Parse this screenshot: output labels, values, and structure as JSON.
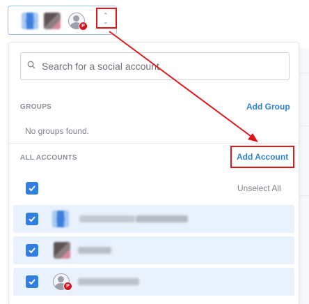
{
  "search": {
    "placeholder": "Search for a social account"
  },
  "groups": {
    "label": "GROUPS",
    "add_label": "Add Group",
    "empty_text": "No groups found."
  },
  "accounts": {
    "label": "ALL ACCOUNTS",
    "add_label": "Add Account",
    "unselect_label": "Unselect All",
    "items": [
      {
        "avatar": "blurred-blue-avatar",
        "checked": true,
        "name_redacted": true
      },
      {
        "avatar": "blurred-gray-avatar",
        "checked": true,
        "name_redacted": true
      },
      {
        "avatar": "default-user-avatar",
        "network": "pinterest",
        "checked": true,
        "name_redacted": true
      }
    ]
  },
  "colors": {
    "accent": "#2f7ee0",
    "link": "#2d7fd6",
    "highlight_red": "#e2141c",
    "selected_row_bg": "#e8f1fc",
    "pinterest": "#d5121f"
  },
  "pinterest_badge_glyph": "P"
}
